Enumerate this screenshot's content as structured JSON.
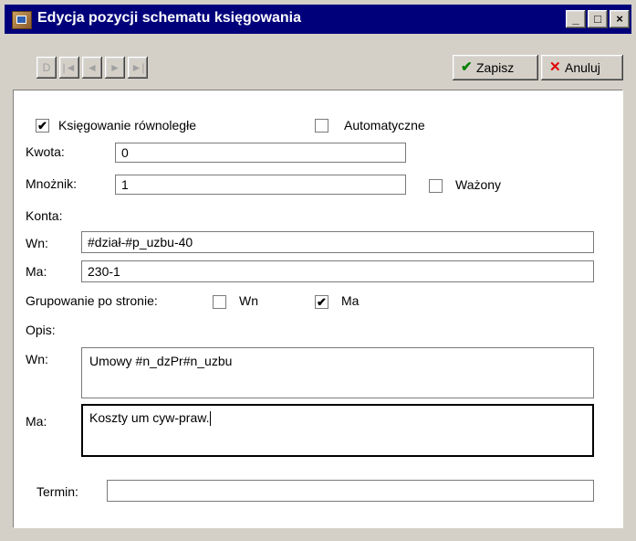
{
  "window": {
    "title": "Edycja pozycji schematu księgowania",
    "controls": {
      "minimize": "_",
      "maximize": "□",
      "close": "×"
    }
  },
  "toolbar": {
    "nav_buttons": [
      "D",
      "|◄",
      "◄",
      "►",
      "►|"
    ],
    "save": {
      "icon": "✔",
      "label": "Zapisz",
      "icon_color": "#008000"
    },
    "cancel": {
      "icon": "✕",
      "label": "Anuluj",
      "icon_color": "#e00000"
    }
  },
  "form": {
    "parallel": {
      "label": "Księgowanie równoległe",
      "checked": true,
      "mark": "✔"
    },
    "automatic": {
      "label": "Automatyczne",
      "checked": false,
      "mark": ""
    },
    "amount": {
      "label": "Kwota:",
      "value": "0"
    },
    "multiplier": {
      "label": "Mnożnik:",
      "value": "1"
    },
    "weighted": {
      "label": "Ważony",
      "checked": false,
      "mark": ""
    },
    "accounts": {
      "heading": "Konta:",
      "debit": {
        "label": "Wn:",
        "value": "#dział-#p_uzbu-40"
      },
      "credit": {
        "label": "Ma:",
        "value": "230-1"
      }
    },
    "grouping": {
      "label": "Grupowanie po stronie:",
      "debit": {
        "label": "Wn",
        "checked": false,
        "mark": ""
      },
      "credit": {
        "label": "Ma",
        "checked": true,
        "mark": "✔"
      }
    },
    "description": {
      "heading": "Opis:",
      "debit": {
        "label": "Wn:",
        "value": "Umowy #n_dzPr#n_uzbu"
      },
      "credit": {
        "label": "Ma:",
        "value": "Koszty um cyw-praw."
      }
    },
    "term": {
      "label": "Termin:",
      "value": ""
    }
  }
}
